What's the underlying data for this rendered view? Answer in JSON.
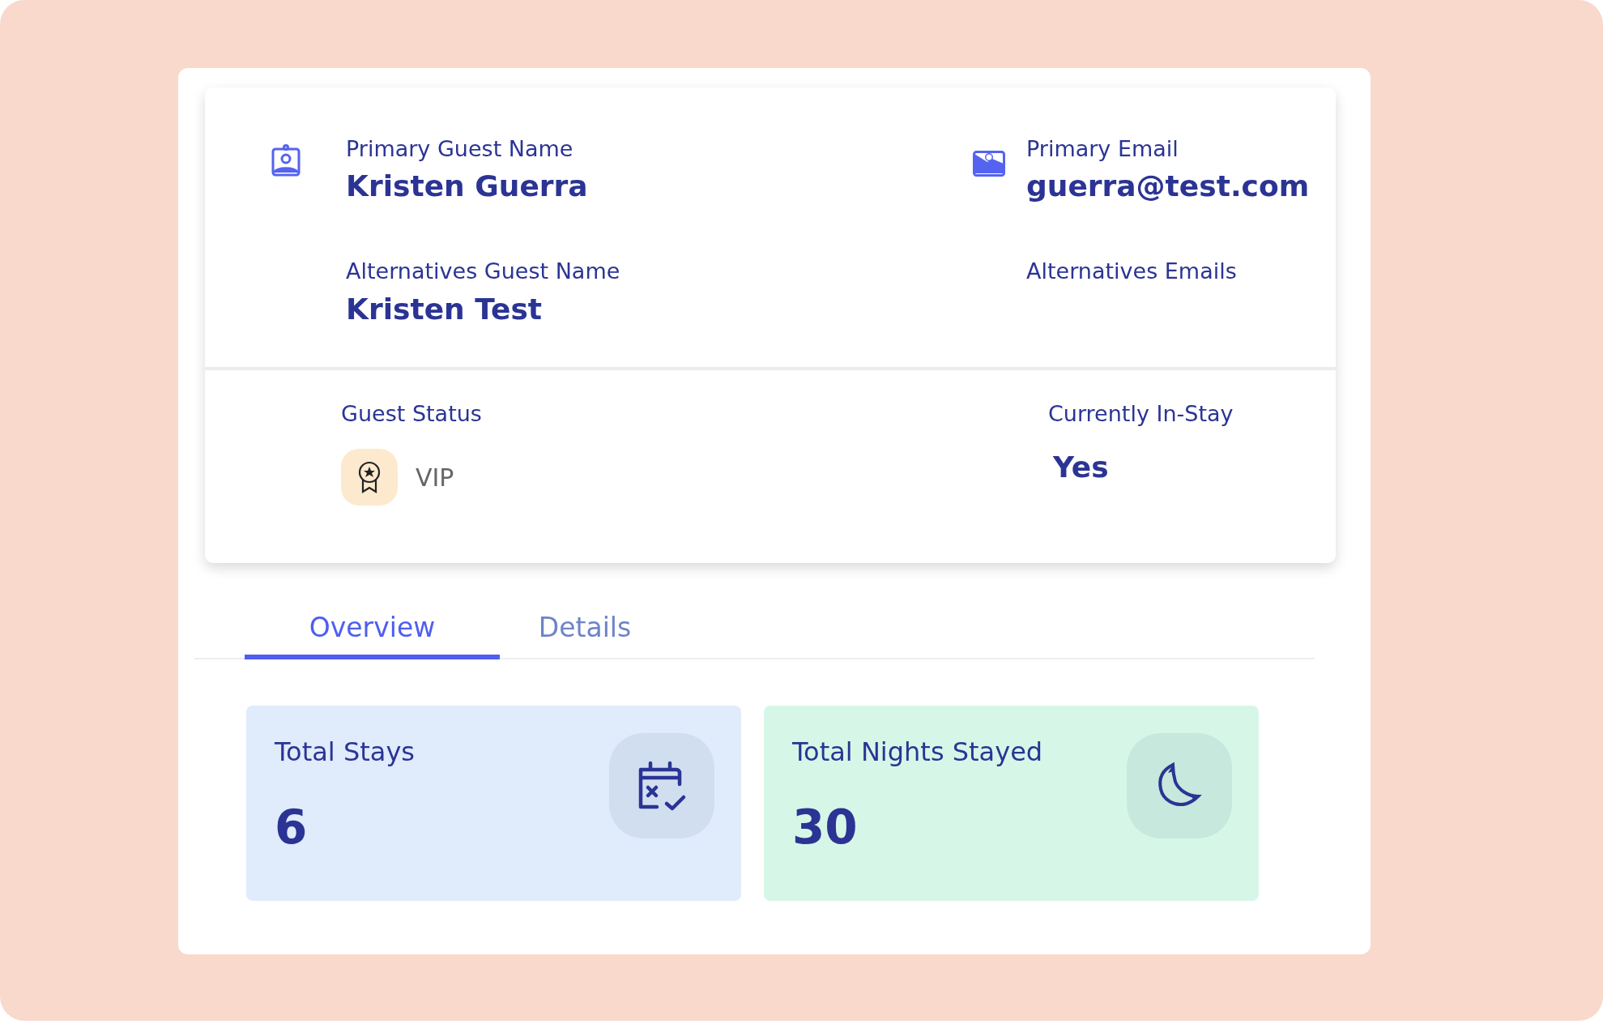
{
  "guest_card": {
    "primary_name": {
      "label": "Primary Guest Name",
      "value": "Kristen Guerra"
    },
    "primary_email": {
      "label": "Primary Email",
      "value": "guerra@test.com"
    },
    "alternative_name": {
      "label": "Alternatives Guest Name",
      "value": "Kristen Test"
    },
    "alternative_emails": {
      "label": "Alternatives Emails"
    },
    "guest_status": {
      "label": "Guest Status",
      "value": "VIP"
    },
    "in_stay": {
      "label": "Currently In-Stay",
      "value": "Yes"
    }
  },
  "tabs": [
    {
      "label": "Overview",
      "selected": true
    },
    {
      "label": "Details",
      "selected": false
    }
  ],
  "stats": [
    {
      "kind": "stays",
      "label": "Total Stays",
      "value": "6"
    },
    {
      "kind": "nights",
      "label": "Total Nights Stayed",
      "value": "30"
    }
  ]
}
